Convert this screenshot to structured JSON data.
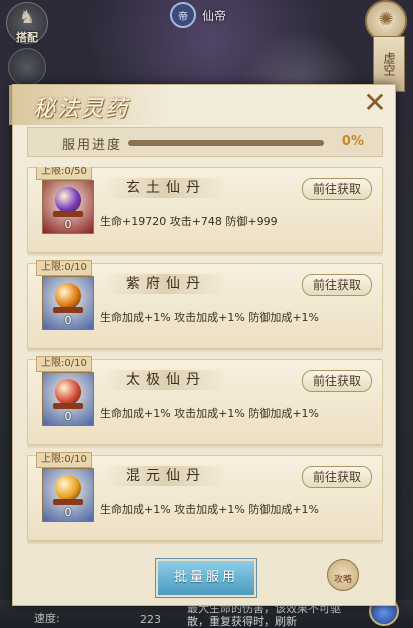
{
  "hud": {
    "outfit_label": "搭配",
    "center_title": "仙帝",
    "center_emblem": "帝",
    "right_scroll_text": "虚空",
    "speed_label": "速度:",
    "speed_value": "223",
    "skill_desc": "最大生命的伤害，该效果不可驱散，重复获得时，刷新"
  },
  "modal": {
    "title": "秘法灵药",
    "progress_label": "服用进度",
    "progress_value": 0,
    "progress_text": "0%",
    "items": [
      {
        "limit": "上限:0/50",
        "name": "玄土仙丹",
        "count": "0",
        "button": "前往获取",
        "stats": "生命+19720 攻击+748 防御+999",
        "orb_color": "#7a3ac0",
        "icon_bg": "#8a2020"
      },
      {
        "limit": "上限:0/10",
        "name": "紫府仙丹",
        "count": "0",
        "button": "前往获取",
        "stats": "生命加成+1% 攻击加成+1% 防御加成+1%",
        "orb_color": "#e07a10",
        "icon_bg": "#4a66a8"
      },
      {
        "limit": "上限:0/10",
        "name": "太极仙丹",
        "count": "0",
        "button": "前往获取",
        "stats": "生命加成+1% 攻击加成+1% 防御加成+1%",
        "orb_color": "#d84a3a",
        "icon_bg": "#4a66a8"
      },
      {
        "limit": "上限:0/10",
        "name": "混元仙丹",
        "count": "0",
        "button": "前往获取",
        "stats": "生命加成+1% 攻击加成+1% 防御加成+1%",
        "orb_color": "#e8a020",
        "icon_bg": "#4a66a8"
      }
    ],
    "batch_button": "批量服用",
    "guide_button": "攻略"
  }
}
